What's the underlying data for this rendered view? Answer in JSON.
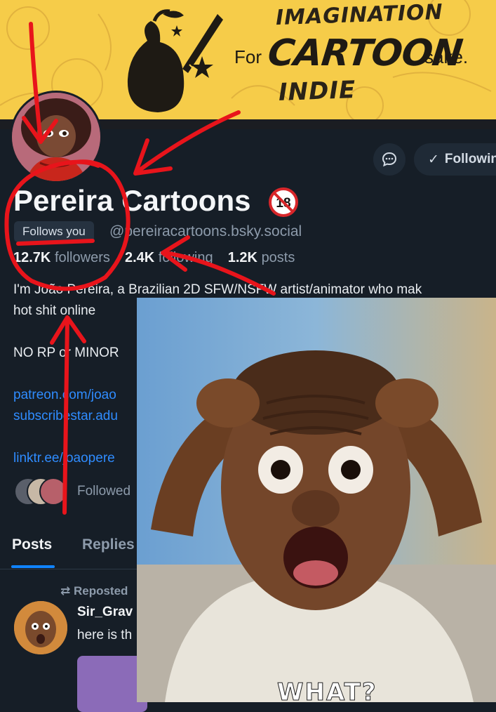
{
  "banner": {
    "line1": "IMAGINATION",
    "for": "For",
    "big": "CARTOON",
    "sake": "sake.",
    "line3": "INDIE"
  },
  "profile": {
    "display_name": "Pereira Cartoons",
    "age_badge": "18",
    "follows_you": "Follows you",
    "handle": "@pereiracartoons.bsky.social",
    "followers_count": "12.7K",
    "followers_label": "followers",
    "following_count": "2.4K",
    "following_label": "following",
    "posts_count": "1.2K",
    "posts_label": "posts",
    "following_button": "Following",
    "bio": {
      "line1": "I'm João Pereira, a Brazilian 2D SFW/NSFW artist/animator who mak",
      "line2": "hot shit online",
      "line3": "NO RP or MINOR",
      "link1": "patreon.com/joao",
      "link2": "subscribestar.adu",
      "link3": "linktr.ee/joaopere"
    },
    "followed_by": "Followed"
  },
  "tabs": {
    "posts": "Posts",
    "replies": "Replies"
  },
  "post": {
    "repost_label": "⇄ Reposted",
    "author": "Sir_Grav",
    "text": "here is th"
  },
  "reaction_image": {
    "caption": "WHAT?"
  },
  "colors": {
    "background": "#161e27",
    "banner": "#f6cc49",
    "link": "#2f8cff",
    "accent_tab": "#1083fe",
    "annotation": "#e8141b"
  }
}
